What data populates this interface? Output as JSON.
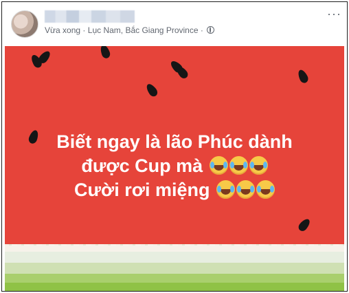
{
  "post": {
    "timestamp": "Vừa xong",
    "separator": "·",
    "location": "Lục Nam, Bắc Giang Province",
    "privacy_icon": "globe-icon",
    "more_label": "···"
  },
  "image": {
    "background_color": "#e6443a",
    "caption_lines": [
      "Biết ngay là lão Phúc dành",
      "được Cup mà",
      "Cười rơi miệng"
    ],
    "emoji_name": "face-with-tears-of-joy-icon"
  }
}
